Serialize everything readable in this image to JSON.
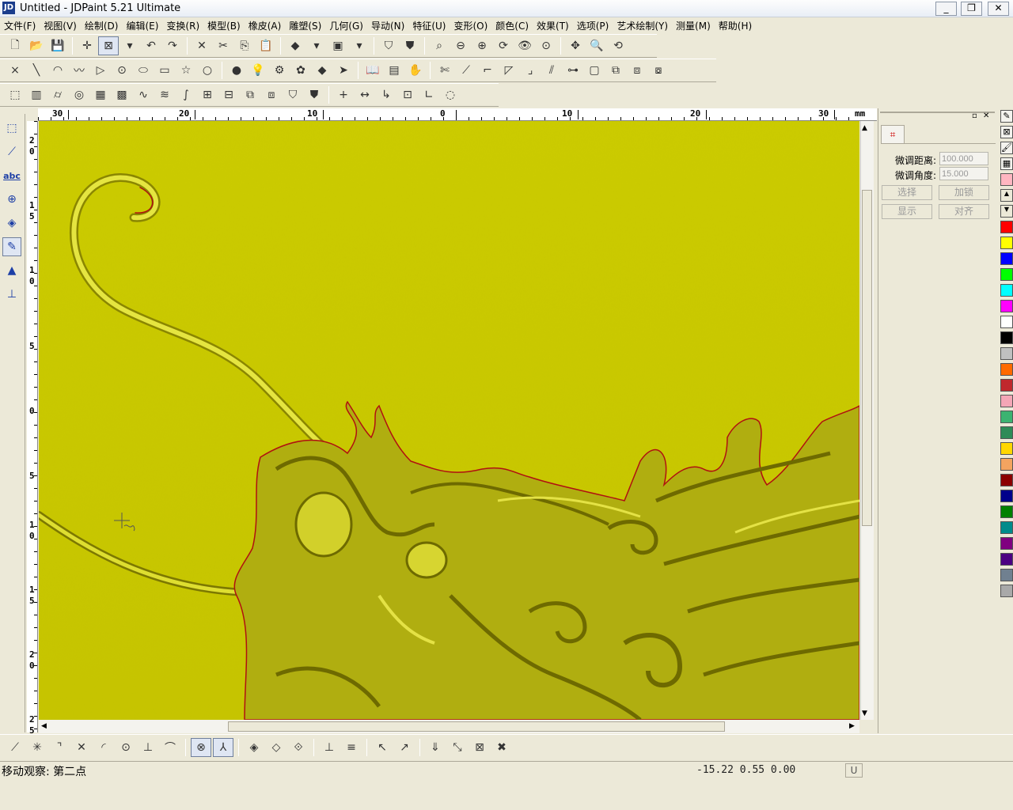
{
  "window": {
    "title": "Untitled - JDPaint 5.21 Ultimate",
    "app_icon": "JD",
    "minimize": "_",
    "restore": "❐",
    "close": "✕"
  },
  "menubar": [
    "文件(F)",
    "视图(V)",
    "绘制(D)",
    "编辑(E)",
    "变换(R)",
    "模型(B)",
    "橡皮(A)",
    "雕塑(S)",
    "几何(G)",
    "导动(N)",
    "特征(U)",
    "变形(O)",
    "颜色(C)",
    "效果(T)",
    "选项(P)",
    "艺术绘制(Y)",
    "测量(M)",
    "帮助(H)"
  ],
  "toolbar1": [
    {
      "name": "new-file-icon",
      "glyph": "🗋"
    },
    {
      "name": "open-file-icon",
      "glyph": "📂"
    },
    {
      "name": "save-icon",
      "glyph": "💾"
    },
    "|",
    {
      "name": "crosshair-icon",
      "glyph": "✛"
    },
    {
      "name": "select-mode-icon",
      "glyph": "⊠",
      "on": true
    },
    {
      "name": "dropdown-arrow-icon",
      "glyph": "▾"
    },
    {
      "name": "undo-icon",
      "glyph": "↶"
    },
    {
      "name": "redo-icon",
      "glyph": "↷"
    },
    "|",
    {
      "name": "delete-icon",
      "glyph": "✕"
    },
    {
      "name": "cut-icon",
      "glyph": "✂"
    },
    {
      "name": "copy-icon",
      "glyph": "⎘"
    },
    {
      "name": "paste-icon",
      "glyph": "📋"
    },
    "|",
    {
      "name": "shade-color-icon",
      "glyph": "◆"
    },
    {
      "name": "dropdown-arrow-icon",
      "glyph": "▾"
    },
    {
      "name": "view-cube-icon",
      "glyph": "▣"
    },
    {
      "name": "dropdown-arrow-icon",
      "glyph": "▾"
    },
    "|",
    {
      "name": "mask-shield-icon",
      "glyph": "⛉"
    },
    {
      "name": "shield-fill-icon",
      "glyph": "⛊"
    },
    "|",
    {
      "name": "zoom-window-icon",
      "glyph": "⌕"
    },
    {
      "name": "zoom-minus-icon",
      "glyph": "⊖"
    },
    {
      "name": "zoom-plus-icon",
      "glyph": "⊕"
    },
    {
      "name": "zoom-refresh-icon",
      "glyph": "⟳"
    },
    {
      "name": "view-eye-icon",
      "glyph": "👁"
    },
    {
      "name": "zoom-fit-icon",
      "glyph": "⊙"
    },
    "|",
    {
      "name": "pan-icon",
      "glyph": "✥"
    },
    {
      "name": "zoom-icon",
      "glyph": "🔍"
    },
    {
      "name": "rotate-view-icon",
      "glyph": "⟲"
    }
  ],
  "toolbar2": [
    {
      "name": "point-icon",
      "glyph": "×"
    },
    {
      "name": "line-icon",
      "glyph": "╲"
    },
    {
      "name": "arc-icon",
      "glyph": "◠"
    },
    {
      "name": "polyline-icon",
      "glyph": "〰"
    },
    {
      "name": "triangle-icon",
      "glyph": "▷"
    },
    {
      "name": "circle-icon",
      "glyph": "⊙"
    },
    {
      "name": "ellipse-icon",
      "glyph": "⬭"
    },
    {
      "name": "rectangle-icon",
      "glyph": "▭"
    },
    {
      "name": "star-icon",
      "glyph": "☆"
    },
    {
      "name": "circle-outline-icon",
      "glyph": "○"
    },
    "|",
    {
      "name": "bulb-green-icon",
      "glyph": "●"
    },
    {
      "name": "bulb-yellow-icon",
      "glyph": "💡"
    },
    {
      "name": "gear-cluster-icon",
      "glyph": "⚙"
    },
    {
      "name": "palette-dots-icon",
      "glyph": "✿"
    },
    {
      "name": "diamond-icon",
      "glyph": "◆"
    },
    {
      "name": "arrow-right-icon",
      "glyph": "➤"
    },
    "|",
    {
      "name": "book-icon",
      "glyph": "📖"
    },
    {
      "name": "hatch-icon",
      "glyph": "▤"
    },
    {
      "name": "hand-icon",
      "glyph": "✋"
    },
    "|",
    {
      "name": "trim-icon",
      "glyph": "✄"
    },
    {
      "name": "extend-icon",
      "glyph": "⟋"
    },
    {
      "name": "fillet-icon",
      "glyph": "⌐"
    },
    {
      "name": "chamfer-icon",
      "glyph": "◸"
    },
    {
      "name": "corner-icon",
      "glyph": "⌟"
    },
    {
      "name": "offset-icon",
      "glyph": "⫽"
    },
    {
      "name": "link-icon",
      "glyph": "⊶"
    },
    {
      "name": "frame-icon",
      "glyph": "▢"
    },
    {
      "name": "group-icon",
      "glyph": "⧉"
    },
    {
      "name": "ungroup-icon",
      "glyph": "⧈"
    },
    {
      "name": "layers-icon",
      "glyph": "⧇"
    }
  ],
  "toolbar3": [
    {
      "name": "model-box-icon",
      "glyph": "⬚"
    },
    {
      "name": "columns-icon",
      "glyph": "▥"
    },
    {
      "name": "cylinder-icon",
      "glyph": "⌭"
    },
    {
      "name": "drum-icon",
      "glyph": "◎"
    },
    {
      "name": "block-icon",
      "glyph": "▦"
    },
    {
      "name": "grid-icon",
      "glyph": "▩"
    },
    {
      "name": "wave-icon",
      "glyph": "∿"
    },
    {
      "name": "wave-dense-icon",
      "glyph": "≋"
    },
    {
      "name": "curve-icon",
      "glyph": "∫"
    },
    {
      "name": "mesh-icon",
      "glyph": "⊞"
    },
    {
      "name": "mesh-dense-icon",
      "glyph": "⊟"
    },
    {
      "name": "stack-icon",
      "glyph": "⧉"
    },
    {
      "name": "stack-shift-icon",
      "glyph": "⧈"
    },
    {
      "name": "shield-gray-icon",
      "glyph": "⛉"
    },
    {
      "name": "shield-dark-icon",
      "glyph": "⛊"
    },
    "|",
    {
      "name": "plus-icon",
      "glyph": "+"
    },
    {
      "name": "width-icon",
      "glyph": "↔"
    },
    {
      "name": "step-icon",
      "glyph": "↳"
    },
    {
      "name": "box-tool-icon",
      "glyph": "⊡"
    },
    {
      "name": "angle-icon",
      "glyph": "∟"
    },
    {
      "name": "lasso-icon",
      "glyph": "◌"
    }
  ],
  "left_tools": [
    {
      "name": "select-box-icon",
      "glyph": "⬚"
    },
    {
      "name": "node-edit-icon",
      "glyph": "⟋"
    },
    {
      "name": "text-abc-icon",
      "glyph": "abc"
    },
    {
      "name": "shape-circle-icon",
      "glyph": "⊕"
    },
    {
      "name": "sculpt-icon",
      "glyph": "◈"
    },
    {
      "name": "pencil-icon",
      "glyph": "✎",
      "on": true
    },
    {
      "name": "bell-icon",
      "glyph": "▲"
    },
    {
      "name": "measure-icon",
      "glyph": "⊥"
    }
  ],
  "hruler": {
    "unit": "mm",
    "labels": [
      "30",
      "20",
      "10",
      "0",
      "10",
      "20",
      "30"
    ]
  },
  "vruler": {
    "labels": [
      "2\n0",
      "1\n5",
      "1\n0",
      "5",
      "0",
      "5",
      "1\n0",
      "1\n5",
      "2\n0",
      "2\n5"
    ]
  },
  "panel": {
    "close_glyph": "✕",
    "pin_glyph": "▫",
    "tab_icon": "panel-tab-icon",
    "distance_label": "微调距离:",
    "distance_value": "100.000",
    "angle_label": "微调角度:",
    "angle_value": "15.000",
    "btn_select": "选择",
    "btn_lock": "加锁",
    "btn_show": "显示",
    "btn_align": "对齐"
  },
  "palette": {
    "top_icons": [
      "pen-icon",
      "cross-box-icon",
      "brush-icon",
      "pattern-icon"
    ],
    "colors": [
      "#ffb6c1",
      "#ece9d8",
      "#ece9d8",
      "#ff0000",
      "#ffff00",
      "#0000ff",
      "#00ff00",
      "#00ffff",
      "#ff00ff",
      "#ffffff",
      "#000000",
      "#c0c0c0",
      "#ff6a00",
      "#c0282d",
      "#f4a6b6",
      "#3cb371",
      "#2e8b57",
      "#ffd700",
      "#f4a460",
      "#8b0000",
      "#00008b",
      "#008000",
      "#008b8b",
      "#800080",
      "#4b0082",
      "#708090",
      "#a9a9a9"
    ]
  },
  "bottom_tools": [
    {
      "name": "snap-line-icon",
      "glyph": "⟋"
    },
    {
      "name": "snap-star-icon",
      "glyph": "✳"
    },
    {
      "name": "snap-corner-icon",
      "glyph": "⌝"
    },
    {
      "name": "snap-cross-icon",
      "glyph": "✕"
    },
    {
      "name": "snap-arc-icon",
      "glyph": "◜"
    },
    {
      "name": "snap-circle-icon",
      "glyph": "⊙"
    },
    {
      "name": "snap-perp-icon",
      "glyph": "⊥"
    },
    {
      "name": "snap-tangent-icon",
      "glyph": "⌒"
    },
    "|",
    {
      "name": "snap-point-icon",
      "glyph": "⊗",
      "on": true
    },
    {
      "name": "snap-axis-icon",
      "glyph": "⅄",
      "on": true
    },
    "|",
    {
      "name": "snap-diamond-icon",
      "glyph": "◈"
    },
    {
      "name": "snap-diamond2-icon",
      "glyph": "◇"
    },
    {
      "name": "snap-diamond3-icon",
      "glyph": "⟐"
    },
    "|",
    {
      "name": "align-bottom-icon",
      "glyph": "⊥"
    },
    {
      "name": "align-hatch-icon",
      "glyph": "≡"
    },
    "|",
    {
      "name": "cursor-x-icon",
      "glyph": "↖"
    },
    {
      "name": "cursor-red-x-icon",
      "glyph": "↗"
    },
    "|",
    {
      "name": "node-edit2-icon",
      "glyph": "⇓"
    },
    {
      "name": "node-curve-icon",
      "glyph": "⤡"
    },
    {
      "name": "node-box-icon",
      "glyph": "⊠"
    },
    {
      "name": "cancel-red-icon",
      "glyph": "✖"
    }
  ],
  "status": {
    "text": "移动观察: 第二点",
    "coords": "-15.22 0.55 0.00",
    "unit": "U"
  }
}
